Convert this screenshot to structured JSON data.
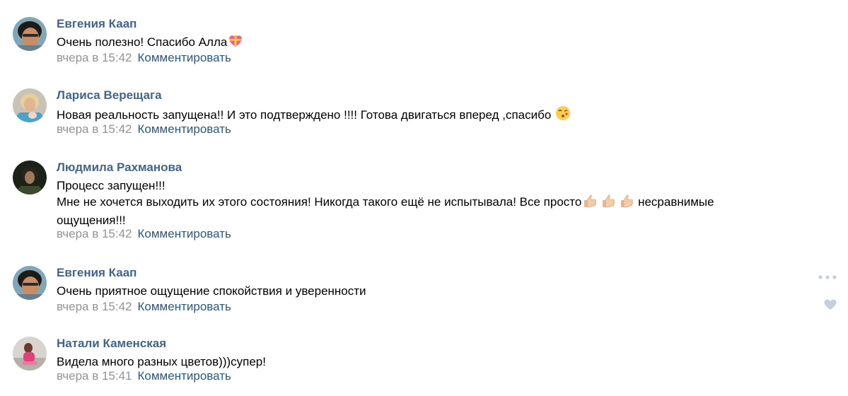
{
  "comments": [
    {
      "author": "Евгения Каап",
      "lines": [
        "Очень полезно! Спасибо Алла"
      ],
      "emoji": "gift-heart",
      "date": "вчера в 15:42",
      "reply": "Комментировать",
      "avatar": "avatar-photo-1"
    },
    {
      "author": "Лариса Верещага",
      "lines": [
        "Новая реальность запущена!! И это подтверждено !!!! Готова двигаться вперед ,спасибо"
      ],
      "emoji": "face-blowing-kiss",
      "date": "вчера в 15:42",
      "reply": "Комментировать",
      "avatar": "avatar-photo-2"
    },
    {
      "author": "Людмила Рахманова",
      "lines": [
        "Процесс запущен!!!",
        "Мне не хочется выходить их этого состояния! Никогда такого ещё не испытывала! Все просто",
        "несравнимые",
        "ощущения!!!"
      ],
      "emoji": "thumbs-up x3",
      "date": "вчера в 15:42",
      "reply": "Комментировать",
      "avatar": "avatar-photo-3"
    },
    {
      "author": "Евгения Каап",
      "lines": [
        "Очень приятное ощущение спокойствия и уверенности"
      ],
      "date": "вчера в 15:42",
      "reply": "Комментировать",
      "avatar": "avatar-photo-1"
    },
    {
      "author": "Натали Каменская",
      "lines": [
        "Видела много разных цветов)))супер!"
      ],
      "date": "вчера в 15:41",
      "reply": "Комментировать",
      "avatar": "avatar-photo-4"
    }
  ],
  "icons": {
    "more": "more-dots-icon",
    "like": "heart-icon"
  },
  "colors": {
    "author": "#42648b",
    "link": "#2a5885",
    "date": "#939393",
    "icon": "#c5d0db"
  }
}
